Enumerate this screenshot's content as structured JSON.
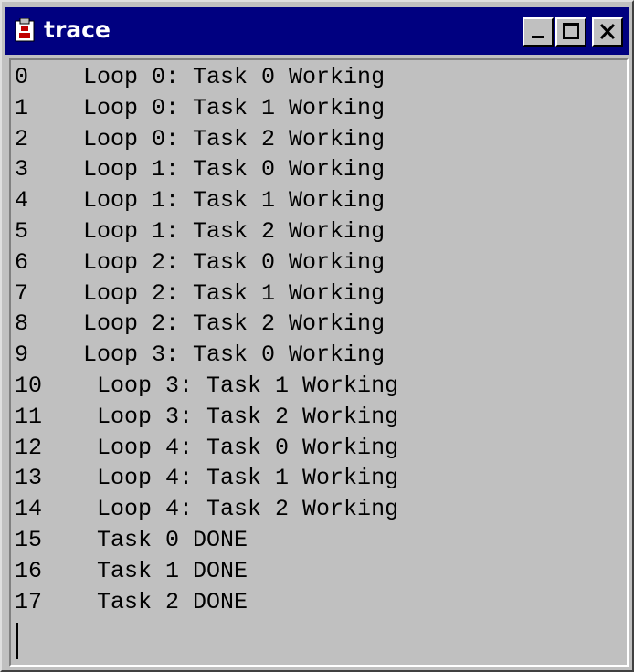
{
  "window": {
    "title": "trace",
    "icon": "app-icon",
    "controls": [
      "minimize-icon",
      "maximize-icon",
      "close-icon"
    ]
  },
  "colors": {
    "titlebar": "#000080",
    "face": "#c0c0c0",
    "text": "#000000"
  },
  "trace": {
    "lines": [
      "0    Loop 0: Task 0 Working",
      "1    Loop 0: Task 1 Working",
      "2    Loop 0: Task 2 Working",
      "3    Loop 1: Task 0 Working",
      "4    Loop 1: Task 1 Working",
      "5    Loop 1: Task 2 Working",
      "6    Loop 2: Task 0 Working",
      "7    Loop 2: Task 1 Working",
      "8    Loop 2: Task 2 Working",
      "9    Loop 3: Task 0 Working",
      "10    Loop 3: Task 1 Working",
      "11    Loop 3: Task 2 Working",
      "12    Loop 4: Task 0 Working",
      "13    Loop 4: Task 1 Working",
      "14    Loop 4: Task 2 Working",
      "15    Task 0 DONE",
      "16    Task 1 DONE",
      "17    Task 2 DONE"
    ]
  }
}
